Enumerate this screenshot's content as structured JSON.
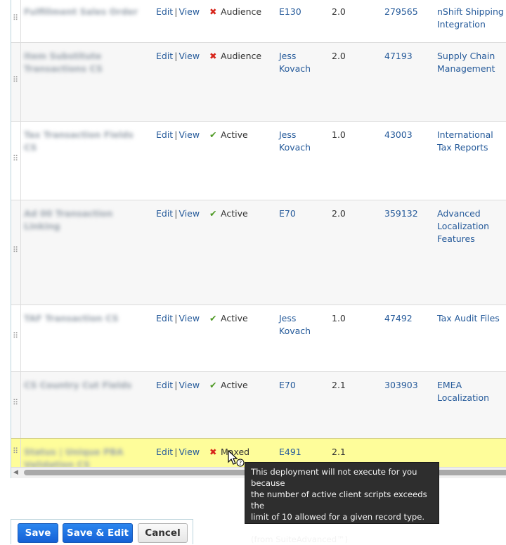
{
  "rows": [
    {
      "name": "Fulfillment Sales Order",
      "edit": "Edit",
      "view": "View",
      "status_icon": "x-icon",
      "status": "Audience",
      "owner": "E130",
      "version": "2.0",
      "id": "279565",
      "app": "nShift Shipping Integration"
    },
    {
      "name": "Item Substitute Transactions CS",
      "edit": "Edit",
      "view": "View",
      "status_icon": "x-icon",
      "status": "Audience",
      "owner": "Jess Kovach",
      "version": "2.0",
      "id": "47193",
      "app": "Supply Chain Management"
    },
    {
      "name": "Tax Transaction Fields CS",
      "edit": "Edit",
      "view": "View",
      "status_icon": "check-icon",
      "status": "Active",
      "owner": "Jess Kovach",
      "version": "1.0",
      "id": "43003",
      "app": "International Tax Reports"
    },
    {
      "name": "Ad 00 Transaction Linking",
      "edit": "Edit",
      "view": "View",
      "status_icon": "check-icon",
      "status": "Active",
      "owner": "E70",
      "version": "2.0",
      "id": "359132",
      "app": "Advanced Localization Features"
    },
    {
      "name": "TAF Transaction CS",
      "edit": "Edit",
      "view": "View",
      "status_icon": "check-icon",
      "status": "Active",
      "owner": "Jess Kovach",
      "version": "1.0",
      "id": "47492",
      "app": "Tax Audit Files"
    },
    {
      "name": "CS Country Cut Fields",
      "edit": "Edit",
      "view": "View",
      "status_icon": "check-icon",
      "status": "Active",
      "owner": "E70",
      "version": "2.1",
      "id": "303903",
      "app": "EMEA Localization"
    },
    {
      "name": "Status | Unique PBA Validation CS",
      "edit": "Edit",
      "view": "View",
      "status_icon": "x-icon",
      "status": "Maxed",
      "owner": "E491",
      "version": "2.1",
      "id": "",
      "app": ""
    }
  ],
  "tooltip": {
    "lines": [
      "This deployment will not execute for you because",
      "the number of active client scripts exceeds the",
      "limit of 10 allowed for a given record type."
    ],
    "source": "(from SuiteAdvanced™)"
  },
  "buttons": {
    "save": "Save",
    "save_edit": "Save & Edit",
    "cancel": "Cancel"
  },
  "colors": {
    "link": "#255a9a",
    "highlight": "#fefd9a",
    "error": "#d7241a",
    "ok": "#4f9a25",
    "primary_button": "#1a73e8"
  }
}
